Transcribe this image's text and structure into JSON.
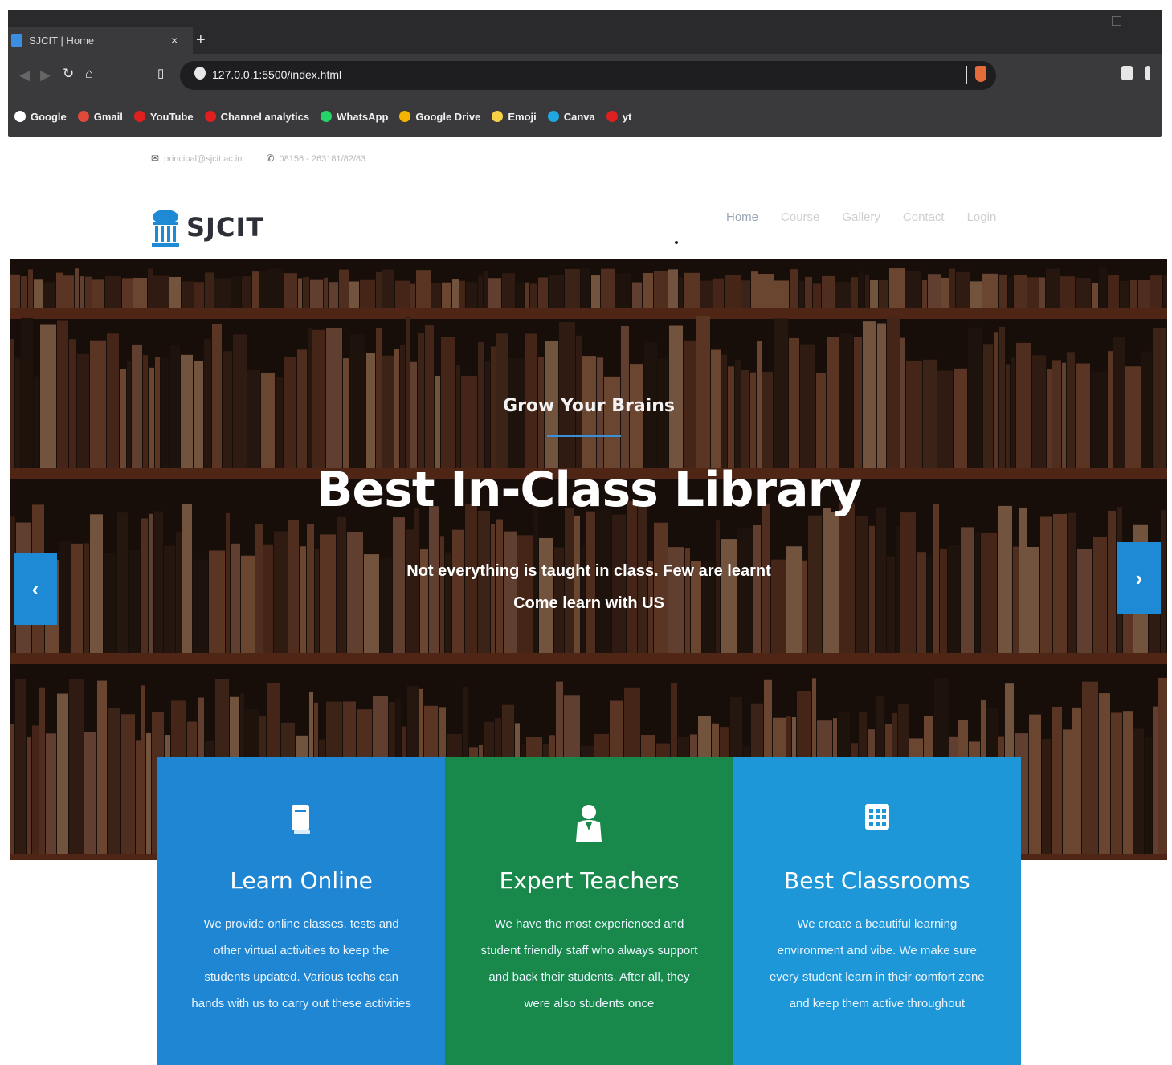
{
  "browser": {
    "tab_title": "SJCIT | Home",
    "tab_close": "×",
    "new_tab": "+",
    "url": "127.0.0.1:5500/index.html",
    "bookmarks": [
      {
        "label": "Google",
        "color": "#ffffff"
      },
      {
        "label": "Gmail",
        "color": "#e04a3a"
      },
      {
        "label": "YouTube",
        "color": "#e02020"
      },
      {
        "label": "Channel analytics",
        "color": "#e02020"
      },
      {
        "label": "WhatsApp",
        "color": "#25d366"
      },
      {
        "label": "Google Drive",
        "color": "#f4b400"
      },
      {
        "label": "Emoji",
        "color": "#f7d046"
      },
      {
        "label": "Canva",
        "color": "#1ea7e0"
      },
      {
        "label": "yt",
        "color": "#e02020"
      }
    ]
  },
  "topbar": {
    "email": "principal@sjcit.ac.in",
    "phone": "08156 - 263181/82/83"
  },
  "logo": {
    "name": "SJCIT"
  },
  "nav": {
    "items": [
      "Home",
      "Course",
      "Gallery",
      "Contact",
      "Login"
    ]
  },
  "hero": {
    "subtitle": "Grow Your Brains",
    "title": "Best In-Class Library",
    "desc_line1": "Not everything is taught in class. Few are learnt",
    "desc_line2": "Come learn with US",
    "prev": "‹",
    "next": "›"
  },
  "cards": [
    {
      "icon": "book-icon",
      "title": "Learn Online",
      "text": "We provide online classes, tests and other virtual activities to keep the students updated. Various techs can hands with us to carry out these activities",
      "color": "#1f86d3"
    },
    {
      "icon": "teacher-icon",
      "title": "Expert Teachers",
      "text": "We have the most experienced and student friendly staff who always support and back their students. After all, they were also students once",
      "color": "#18894a"
    },
    {
      "icon": "grid-icon",
      "title": "Best Classrooms",
      "text": "We create a beautiful learning environment and vibe. We make sure every student learn in their comfort zone and keep them active throughout",
      "color": "#1e97d8"
    }
  ]
}
